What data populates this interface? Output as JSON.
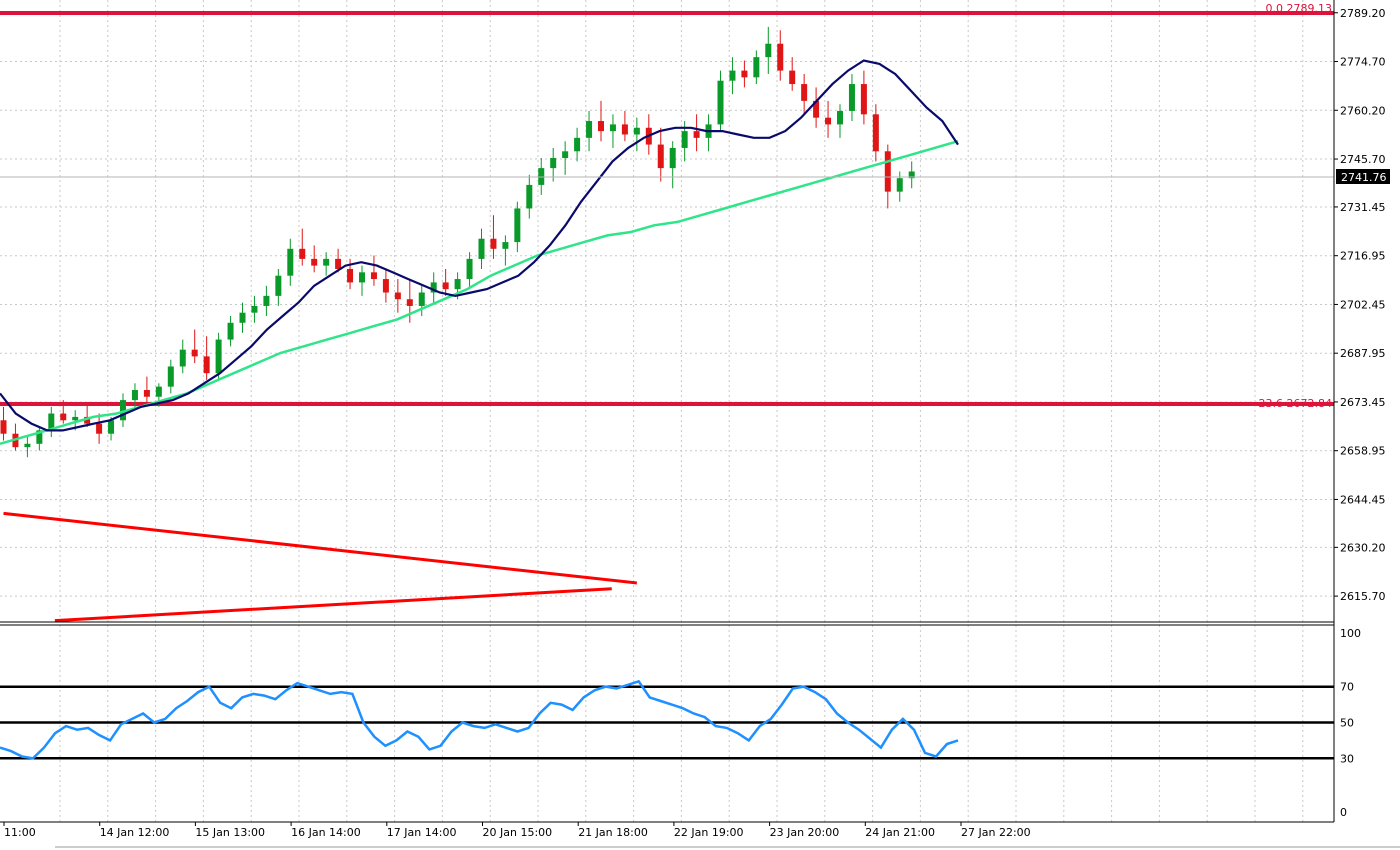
{
  "chart_data": [
    {
      "type": "line",
      "panel": "price",
      "ylim": [
        2608,
        2793
      ],
      "y_ticks": [
        "2789.20",
        "2774.70",
        "2760.20",
        "2745.70",
        "2731.45",
        "2716.95",
        "2702.45",
        "2687.95",
        "2673.45",
        "2658.95",
        "2644.45",
        "2630.20",
        "2615.70"
      ],
      "current_price": "2741.76",
      "current_price_value": 2741.76,
      "fib_levels": [
        {
          "label": "0.0 2789.13",
          "value": 2789.13,
          "color": "#dc143c"
        },
        {
          "label": "23.6 2672.84",
          "value": 2672.84,
          "color": "#dc143c"
        }
      ],
      "trendlines": [
        {
          "points": [
            [
              0,
              2640.3
            ],
            [
              53,
              2619.6
            ]
          ],
          "color": "#ff0000"
        },
        {
          "points": [
            [
              4.3,
              2608.4
            ],
            [
              50.9,
              2617.9
            ]
          ],
          "color": "#ff0000"
        }
      ],
      "candles_ohlc": [
        [
          2668,
          2672,
          2662,
          2664
        ],
        [
          2664,
          2667,
          2659,
          2660
        ],
        [
          2660,
          2663,
          2657,
          2661
        ],
        [
          2661,
          2666,
          2659,
          2665
        ],
        [
          2665,
          2672,
          2663,
          2670
        ],
        [
          2670,
          2674,
          2667,
          2668
        ],
        [
          2668,
          2671,
          2665,
          2669
        ],
        [
          2669,
          2673,
          2666,
          2667
        ],
        [
          2667,
          2670,
          2661,
          2664
        ],
        [
          2664,
          2669,
          2662,
          2668
        ],
        [
          2668,
          2676,
          2666,
          2674
        ],
        [
          2674,
          2679,
          2671,
          2677
        ],
        [
          2677,
          2681,
          2673,
          2675
        ],
        [
          2675,
          2679,
          2672,
          2678
        ],
        [
          2678,
          2686,
          2676,
          2684
        ],
        [
          2684,
          2692,
          2682,
          2689
        ],
        [
          2689,
          2695,
          2685,
          2687
        ],
        [
          2687,
          2693,
          2680,
          2682
        ],
        [
          2682,
          2694,
          2680,
          2692
        ],
        [
          2692,
          2699,
          2690,
          2697
        ],
        [
          2697,
          2703,
          2694,
          2700
        ],
        [
          2700,
          2705,
          2697,
          2702
        ],
        [
          2702,
          2708,
          2699,
          2705
        ],
        [
          2705,
          2713,
          2702,
          2711
        ],
        [
          2711,
          2722,
          2708,
          2719
        ],
        [
          2719,
          2725,
          2714,
          2716
        ],
        [
          2716,
          2720,
          2712,
          2714
        ],
        [
          2714,
          2718,
          2711,
          2716
        ],
        [
          2716,
          2719,
          2712,
          2713
        ],
        [
          2713,
          2716,
          2707,
          2709
        ],
        [
          2709,
          2714,
          2705,
          2712
        ],
        [
          2712,
          2717,
          2708,
          2710
        ],
        [
          2710,
          2713,
          2703,
          2706
        ],
        [
          2706,
          2710,
          2700,
          2704
        ],
        [
          2704,
          2710,
          2697,
          2702
        ],
        [
          2702,
          2708,
          2699,
          2706
        ],
        [
          2706,
          2712,
          2703,
          2709
        ],
        [
          2709,
          2713,
          2705,
          2707
        ],
        [
          2707,
          2712,
          2704,
          2710
        ],
        [
          2710,
          2718,
          2707,
          2716
        ],
        [
          2716,
          2725,
          2713,
          2722
        ],
        [
          2722,
          2729,
          2716,
          2719
        ],
        [
          2719,
          2723,
          2714,
          2721
        ],
        [
          2721,
          2733,
          2718,
          2731
        ],
        [
          2731,
          2741,
          2728,
          2738
        ],
        [
          2738,
          2746,
          2735,
          2743
        ],
        [
          2743,
          2749,
          2739,
          2746
        ],
        [
          2746,
          2751,
          2741,
          2748
        ],
        [
          2748,
          2755,
          2745,
          2752
        ],
        [
          2752,
          2760,
          2748,
          2757
        ],
        [
          2757,
          2763,
          2751,
          2754
        ],
        [
          2754,
          2759,
          2749,
          2756
        ],
        [
          2756,
          2760,
          2751,
          2753
        ],
        [
          2753,
          2758,
          2748,
          2755
        ],
        [
          2755,
          2759,
          2747,
          2750
        ],
        [
          2750,
          2755,
          2739,
          2743
        ],
        [
          2743,
          2751,
          2737,
          2749
        ],
        [
          2749,
          2757,
          2745,
          2754
        ],
        [
          2754,
          2759,
          2748,
          2752
        ],
        [
          2752,
          2759,
          2748,
          2756
        ],
        [
          2756,
          2772,
          2754,
          2769
        ],
        [
          2769,
          2776,
          2765,
          2772
        ],
        [
          2772,
          2775,
          2767,
          2770
        ],
        [
          2770,
          2778,
          2768,
          2776
        ],
        [
          2776,
          2785,
          2771,
          2780
        ],
        [
          2780,
          2784,
          2769,
          2772
        ],
        [
          2772,
          2776,
          2766,
          2768
        ],
        [
          2768,
          2771,
          2759,
          2763
        ],
        [
          2763,
          2767,
          2755,
          2758
        ],
        [
          2758,
          2763,
          2752,
          2756
        ],
        [
          2756,
          2762,
          2752,
          2760
        ],
        [
          2760,
          2771,
          2757,
          2768
        ],
        [
          2768,
          2772,
          2756,
          2759
        ],
        [
          2759,
          2762,
          2745,
          2748
        ],
        [
          2748,
          2750,
          2731,
          2736
        ],
        [
          2736,
          2742,
          2733,
          2740
        ],
        [
          2740,
          2745,
          2737,
          2742
        ]
      ],
      "sma_fast": [
        2676,
        2670,
        2667,
        2665,
        2665,
        2666,
        2667,
        2668,
        2670,
        2672,
        2673,
        2674,
        2676,
        2679,
        2682,
        2686,
        2690,
        2695,
        2699,
        2703,
        2708,
        2711,
        2714,
        2715,
        2714,
        2712,
        2710,
        2708,
        2706,
        2705,
        2706,
        2707,
        2709,
        2711,
        2715,
        2720,
        2726,
        2733,
        2739,
        2745,
        2749,
        2752,
        2754,
        2755,
        2755,
        2754,
        2754,
        2753,
        2752,
        2752,
        2754,
        2758,
        2763,
        2768,
        2772,
        2775,
        2774,
        2771,
        2766,
        2761,
        2757,
        2750
      ],
      "sma_slow": [
        2661,
        2663,
        2665,
        2667,
        2669,
        2670,
        2672,
        2674,
        2676,
        2679,
        2682,
        2685,
        2688,
        2690,
        2692,
        2694,
        2696,
        2698,
        2701,
        2704,
        2707,
        2711,
        2714,
        2717,
        2719,
        2721,
        2723,
        2724,
        2726,
        2727,
        2729,
        2731,
        2733,
        2735,
        2737,
        2739,
        2741,
        2743,
        2745,
        2747,
        2749,
        2751
      ],
      "series": [
        {
          "name": "",
          "color": "#0a0a6b"
        },
        {
          "name": "",
          "color": "#2ee589"
        }
      ]
    },
    {
      "type": "line",
      "panel": "oscillator",
      "ylim": [
        0,
        100
      ],
      "y_ticks": [
        "100",
        "70",
        "50",
        "30",
        "0"
      ],
      "levels": [
        70,
        50,
        30
      ],
      "x_tick_labels": [
        "11:00",
        "14 Jan 12:00",
        "15 Jan 13:00",
        "16 Jan 14:00",
        "17 Jan 14:00",
        "20 Jan 15:00",
        "21 Jan 18:00",
        "22 Jan 19:00",
        "23 Jan 20:00",
        "24 Jan 21:00",
        "27 Jan 22:00"
      ],
      "values": [
        36,
        34,
        31,
        30,
        36,
        44,
        48,
        46,
        47,
        43,
        40,
        49,
        52,
        55,
        50,
        52,
        58,
        62,
        67,
        70,
        61,
        58,
        64,
        66,
        65,
        63,
        68,
        72,
        70,
        68,
        66,
        67,
        66,
        50,
        42,
        37,
        40,
        45,
        42,
        35,
        37,
        45,
        50,
        48,
        47,
        49,
        47,
        45,
        47,
        55,
        61,
        60,
        57,
        64,
        68,
        70,
        69,
        71,
        73,
        64,
        62,
        60,
        58,
        55,
        53,
        48,
        47,
        44,
        40,
        48,
        52,
        60,
        69,
        70,
        67,
        63,
        55,
        50,
        46,
        41,
        36,
        46,
        52,
        46,
        33,
        31,
        38,
        40
      ],
      "series": [
        {
          "name": "",
          "color": "#1e90ff"
        }
      ]
    }
  ]
}
